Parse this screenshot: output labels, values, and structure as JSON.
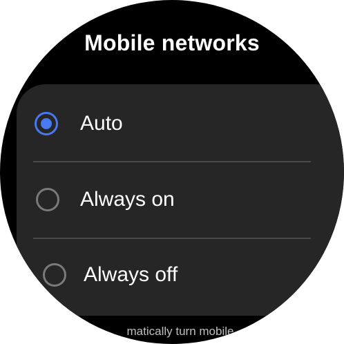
{
  "title": "Mobile networks",
  "options": [
    {
      "label": "Auto",
      "selected": true
    },
    {
      "label": "Always on",
      "selected": false
    },
    {
      "label": "Always off",
      "selected": false
    }
  ],
  "footer_text": "matically turn mobile",
  "colors": {
    "background": "#000000",
    "card": "#262626",
    "accent": "#4a78f0",
    "radio_unselected": "#7a7a7a",
    "divider": "#4a4a4a"
  }
}
